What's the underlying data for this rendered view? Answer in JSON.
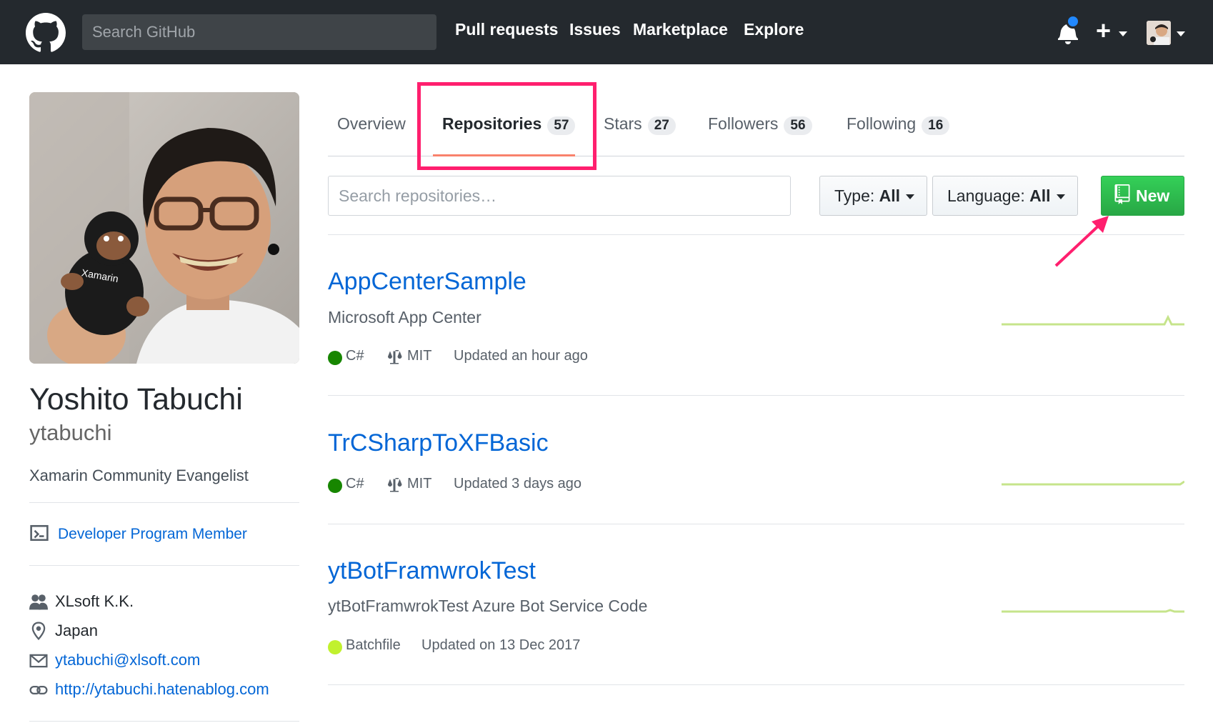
{
  "header": {
    "search_placeholder": "Search GitHub",
    "nav": [
      "Pull requests",
      "Issues",
      "Marketplace",
      "Explore"
    ],
    "plus_label": "+"
  },
  "profile": {
    "fullname": "Yoshito Tabuchi",
    "username": "ytabuchi",
    "bio": "Xamarin Community Evangelist",
    "developer_program": "Developer Program Member",
    "company": "XLsoft K.K.",
    "location": "Japan",
    "email": "ytabuchi@xlsoft.com",
    "website": "http://ytabuchi.hatenablog.com",
    "avatar_shirt_text": "Xamarin"
  },
  "tabs": [
    {
      "label": "Overview",
      "count": ""
    },
    {
      "label": "Repositories",
      "count": "57"
    },
    {
      "label": "Stars",
      "count": "27"
    },
    {
      "label": "Followers",
      "count": "56"
    },
    {
      "label": "Following",
      "count": "16"
    }
  ],
  "filters": {
    "search_placeholder": "Search repositories…",
    "type_label": "Type:",
    "type_value": "All",
    "language_label": "Language:",
    "language_value": "All",
    "new_label": "New"
  },
  "repos": [
    {
      "name": "AppCenterSample",
      "description": "Microsoft App Center",
      "language": "C#",
      "lang_color": "#178600",
      "license": "MIT",
      "updated": "Updated an hour ago"
    },
    {
      "name": "TrCSharpToXFBasic",
      "description": "",
      "language": "C#",
      "lang_color": "#178600",
      "license": "MIT",
      "updated": "Updated 3 days ago"
    },
    {
      "name": "ytBotFramwrokTest",
      "description": "ytBotFramwrokTest Azure Bot Service Code",
      "language": "Batchfile",
      "lang_color": "#C1F12E",
      "license": "",
      "updated": "Updated on 13 Dec 2017"
    }
  ],
  "colors": {
    "accent_highlight": "#ff1f6e",
    "new_button": "#28a745",
    "link": "#0366d6"
  }
}
